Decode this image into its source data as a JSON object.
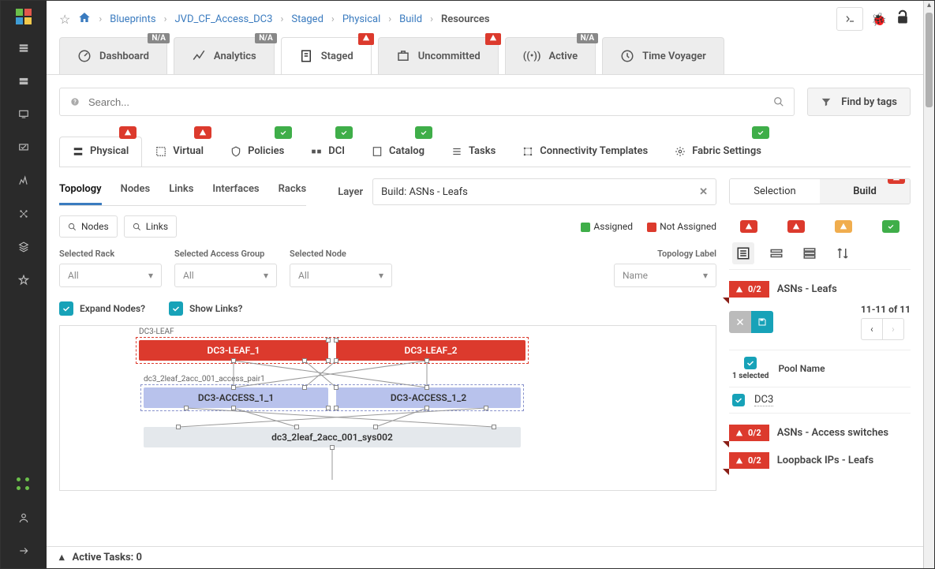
{
  "breadcrumb": [
    "Blueprints",
    "JVD_CF_Access_DC3",
    "Staged",
    "Physical",
    "Build",
    "Resources"
  ],
  "mainTabs": [
    {
      "label": "Dashboard",
      "badge": "N/A",
      "badgeType": "na"
    },
    {
      "label": "Analytics",
      "badge": "N/A",
      "badgeType": "na"
    },
    {
      "label": "Staged",
      "badge": "warn",
      "badgeType": "warn",
      "active": true
    },
    {
      "label": "Uncommitted",
      "badge": "warn",
      "badgeType": "warn"
    },
    {
      "label": "Active",
      "badge": "N/A",
      "badgeType": "na"
    },
    {
      "label": "Time Voyager"
    }
  ],
  "search": {
    "placeholder": "Search..."
  },
  "findTags": "Find by tags",
  "subTabs": [
    {
      "label": "Physical",
      "status": "err",
      "active": true
    },
    {
      "label": "Virtual",
      "status": "err"
    },
    {
      "label": "Policies",
      "status": "ok"
    },
    {
      "label": "DCI",
      "status": "ok"
    },
    {
      "label": "Catalog",
      "status": "ok"
    },
    {
      "label": "Tasks"
    },
    {
      "label": "Connectivity Templates"
    },
    {
      "label": "Fabric Settings",
      "status": "ok"
    }
  ],
  "innerTabs": [
    "Topology",
    "Nodes",
    "Links",
    "Interfaces",
    "Racks"
  ],
  "innerActive": "Topology",
  "layer": {
    "label": "Layer",
    "value": "Build: ASNs - Leafs"
  },
  "searchButtons": {
    "nodes": "Nodes",
    "links": "Links"
  },
  "legend": {
    "assigned": "Assigned",
    "notAssigned": "Not Assigned"
  },
  "filters": {
    "rack": {
      "label": "Selected Rack",
      "value": "All"
    },
    "ag": {
      "label": "Selected Access Group",
      "value": "All"
    },
    "node": {
      "label": "Selected Node",
      "value": "All"
    },
    "topoLabel": {
      "label": "Topology Label",
      "value": "Name"
    }
  },
  "toggles": {
    "expand": "Expand Nodes?",
    "links": "Show Links?"
  },
  "topology": {
    "group1": "DC3-LEAF",
    "leaf1": "DC3-LEAF_1",
    "leaf2": "DC3-LEAF_2",
    "pair": "dc3_2leaf_2acc_001_access_pair1",
    "acc1": "DC3-ACCESS_1_1",
    "acc2": "DC3-ACCESS_1_2",
    "sys": "dc3_2leaf_2acc_001_sys002"
  },
  "rightTabs": {
    "selection": "Selection",
    "build": "Build"
  },
  "sections": [
    {
      "count": "0/2",
      "name": "ASNs - Leafs"
    },
    {
      "count": "0/2",
      "name": "ASNs - Access switches"
    },
    {
      "count": "0/2",
      "name": "Loopback IPs - Leafs"
    }
  ],
  "pager": {
    "text": "11-11 of 11"
  },
  "pool": {
    "header": "Pool Name",
    "selected": "1 selected",
    "row": "DC3"
  },
  "footer": {
    "label": "Active Tasks: 0"
  }
}
